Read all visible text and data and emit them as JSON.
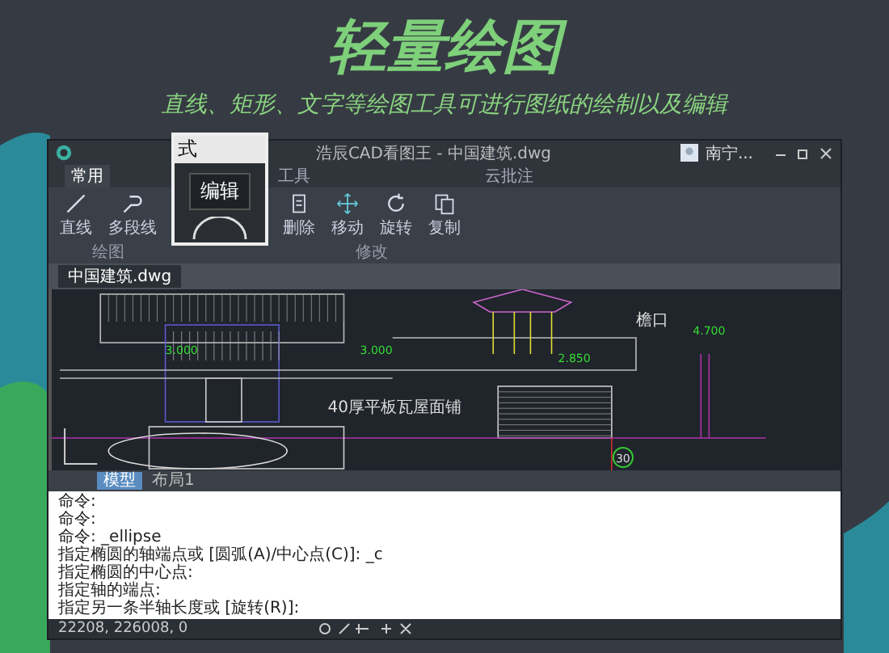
{
  "banner": {
    "title": "轻量绘图",
    "subtitle": "直线、矩形、文字等绘图工具可进行图纸的绘制以及编辑"
  },
  "callout": {
    "heading": "式",
    "button": "编辑"
  },
  "window": {
    "title": "浩辰CAD看图王 - 中国建筑.dwg",
    "user": "南宁..."
  },
  "tabs": [
    {
      "label": "常用",
      "selected": true
    },
    {
      "label": "工具",
      "selected": false
    },
    {
      "label": "云批注",
      "selected": false
    }
  ],
  "ribbon": [
    {
      "label": "绘图",
      "tools": [
        {
          "label": "直线",
          "kind": "line"
        },
        {
          "label": "多段线",
          "kind": "polyline"
        }
      ]
    },
    {
      "label": "修改",
      "tools": [
        {
          "label": "删除",
          "kind": "erase"
        },
        {
          "label": "移动",
          "kind": "move"
        },
        {
          "label": "旋转",
          "kind": "rotate"
        },
        {
          "label": "复制",
          "kind": "copy"
        }
      ]
    }
  ],
  "file_tabs": [
    {
      "label": "中国建筑.dwg",
      "selected": true
    }
  ],
  "drawing": {
    "elevations": [
      "3.000",
      "3.000",
      "2.850",
      "4.700"
    ],
    "eave_label": "檐口",
    "note": "40厚平板瓦屋面铺",
    "axis_label": "30"
  },
  "command_tabs": [
    {
      "label": "模型",
      "selected": true
    },
    {
      "label": "布局1",
      "selected": false
    }
  ],
  "command_lines": [
    "命令:",
    "命令:",
    "命令: _ellipse",
    "指定椭圆的轴端点或 [圆弧(A)/中心点(C)]: _c",
    "指定椭圆的中心点:",
    "指定轴的端点:",
    "指定另一条半轴长度或 [旋转(R)]:"
  ],
  "status": {
    "coords": "22208, 226008, 0"
  }
}
